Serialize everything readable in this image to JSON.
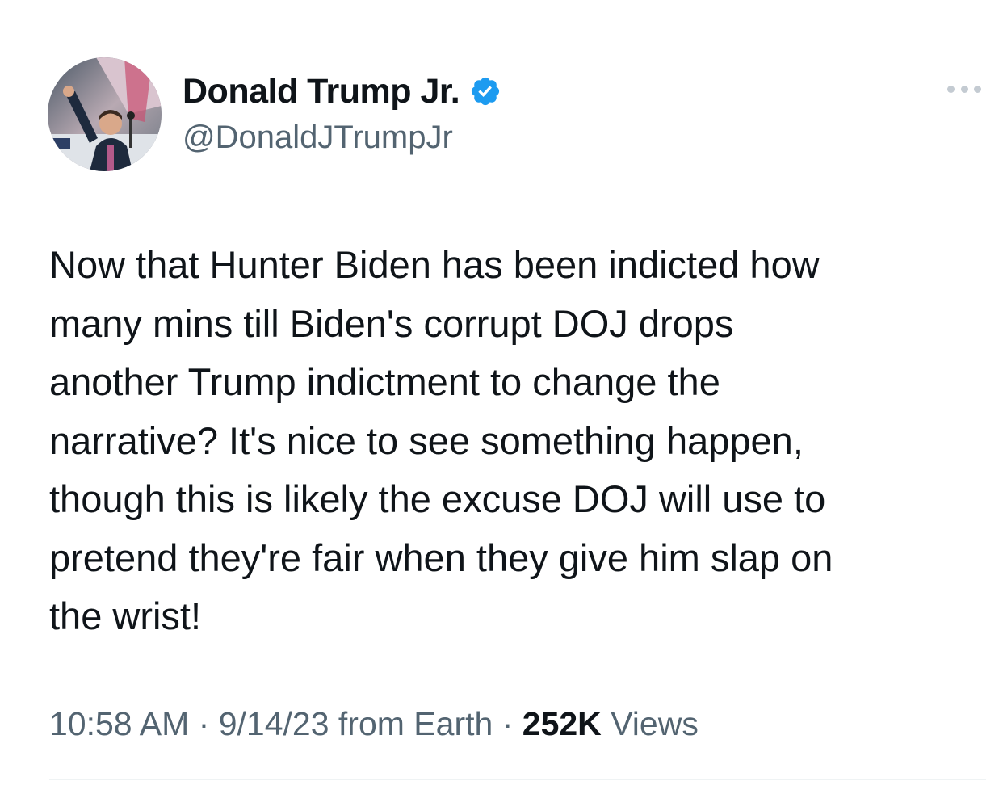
{
  "author": {
    "display_name": "Donald Trump Jr.",
    "handle": "@DonaldJTrumpJr",
    "verified": true,
    "verified_color": "#1d9bf0"
  },
  "tweet": {
    "lines": [
      "Now that Hunter Biden has been indicted how",
      "many mins till Biden's corrupt DOJ drops",
      "another Trump indictment to change the",
      "narrative? It's nice to see something happen,",
      "though this is likely the excuse DOJ will use to",
      "pretend they're fair when they give him slap on",
      "the wrist!"
    ]
  },
  "meta": {
    "time": "10:58 AM",
    "separator": "·",
    "date": "9/14/23",
    "source": "from Earth",
    "views_count": "252K",
    "views_label": "Views"
  },
  "icons": {
    "more": "more-horizontal-icon",
    "verified": "verified-badge-icon"
  },
  "colors": {
    "text_primary": "#0f1419",
    "text_secondary": "#536471",
    "divider": "#eff3f4",
    "accent": "#1d9bf0"
  }
}
